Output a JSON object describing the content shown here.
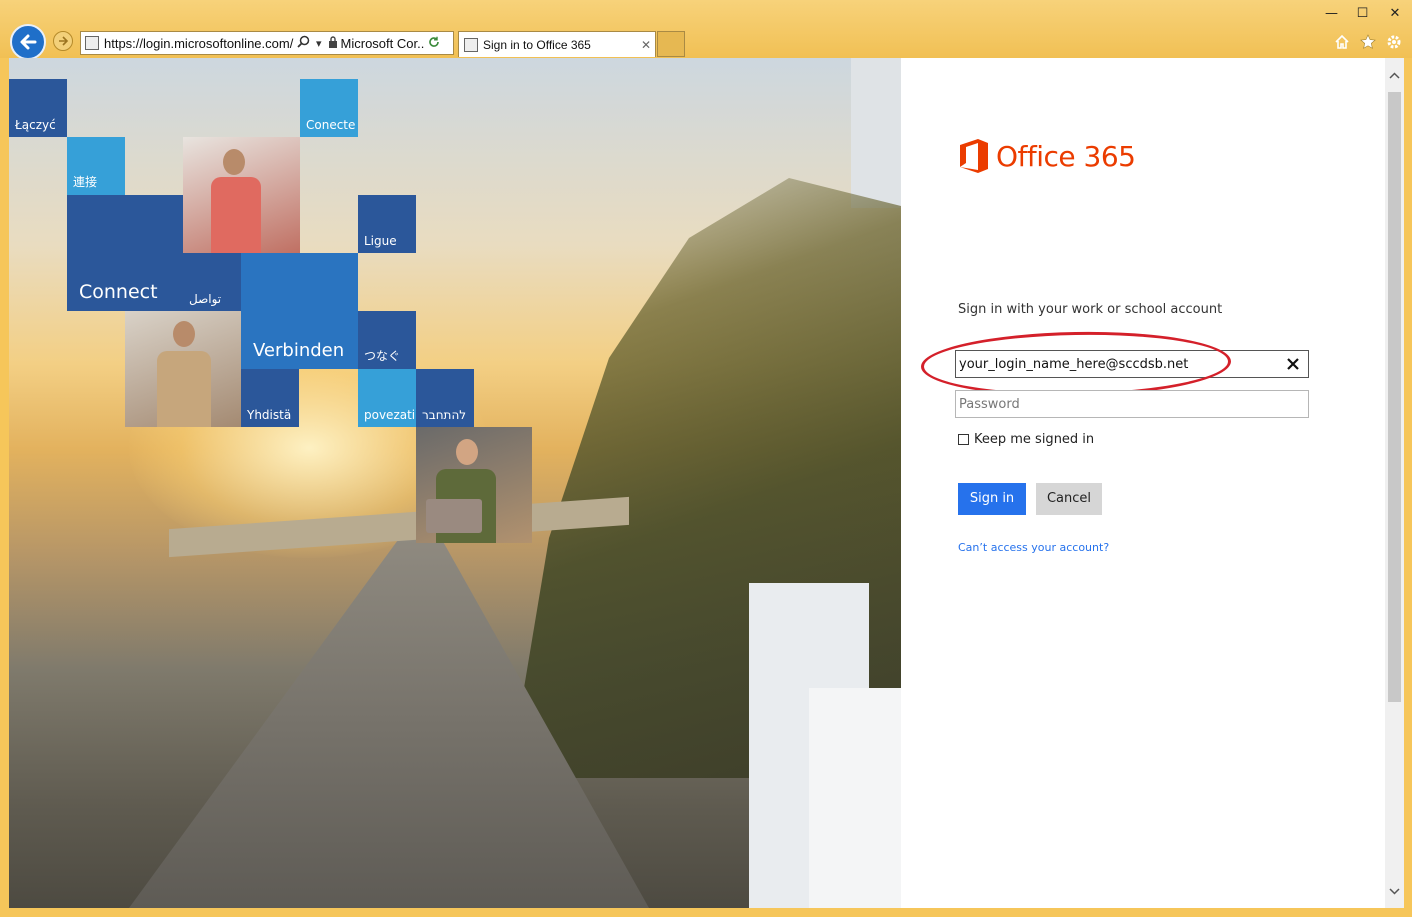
{
  "browser": {
    "url": "https://login.microsoftonline.com/",
    "url_display": "https://login.microsoftonline.com/l",
    "site_identity": "Microsoft Cor...",
    "tab_title": "Sign in to Office 365",
    "tab_close": "✕",
    "controls": {
      "minimize": "—",
      "maximize": "☐",
      "close": "✕"
    }
  },
  "hero": {
    "tiles": [
      "Łączyć",
      "Conecte",
      "連接",
      "Connect",
      "تواصل",
      "Ligue",
      "Verbinden",
      "つなぐ",
      "Yhdistä",
      "povezati",
      "להתחבר"
    ]
  },
  "signin": {
    "brand": "Office 365",
    "heading": "Sign in with your work or school account",
    "email_value": "your_login_name_here@sccdsb.net",
    "password_placeholder": "Password",
    "keep_signed_in": "Keep me signed in",
    "sign_in_label": "Sign in",
    "cancel_label": "Cancel",
    "cant_access": "Can’t access your account?"
  },
  "colors": {
    "brand_orange": "#eb3c00",
    "primary_button": "#2672ec",
    "annotation_red": "#d4202a",
    "ie_frame": "#f1c054"
  }
}
